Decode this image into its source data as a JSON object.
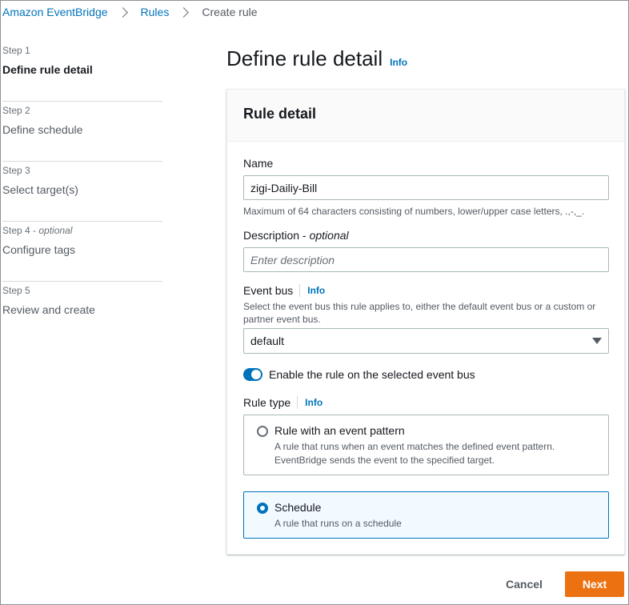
{
  "breadcrumb": [
    {
      "label": "Amazon EventBridge"
    },
    {
      "label": "Rules"
    },
    {
      "label": "Create rule"
    }
  ],
  "steps": [
    {
      "num": "Step 1",
      "optional": "",
      "title": "Define rule detail"
    },
    {
      "num": "Step 2",
      "optional": "",
      "title": "Define schedule"
    },
    {
      "num": "Step 3",
      "optional": "",
      "title": "Select target(s)"
    },
    {
      "num": "Step 4 - ",
      "optional": "optional",
      "title": "Configure tags"
    },
    {
      "num": "Step 5",
      "optional": "",
      "title": "Review and create"
    }
  ],
  "page": {
    "title": "Define rule detail",
    "info": "Info"
  },
  "rule_detail": {
    "heading": "Rule detail",
    "name_label": "Name",
    "name_value": "zigi-Dailiy-Bill",
    "name_hint": "Maximum of 64 characters consisting of numbers, lower/upper case letters, .,-,_.",
    "desc_label": "Description - ",
    "desc_optional": "optional",
    "desc_placeholder": "Enter description",
    "event_bus_label": "Event bus",
    "event_bus_info": "Info",
    "event_bus_hint": "Select the event bus this rule applies to, either the default event bus or a custom or partner event bus.",
    "event_bus_value": "default",
    "enable_label": "Enable the rule on the selected event bus",
    "rule_type_label": "Rule type",
    "rule_type_info": "Info",
    "options": [
      {
        "title": "Rule with an event pattern",
        "desc": "A rule that runs when an event matches the defined event pattern. EventBridge sends the event to the specified target."
      },
      {
        "title": "Schedule",
        "desc": "A rule that runs on a schedule"
      }
    ]
  },
  "footer": {
    "cancel": "Cancel",
    "next": "Next"
  },
  "colors": {
    "accent": "#0073bb",
    "primary_button": "#ec7211"
  }
}
